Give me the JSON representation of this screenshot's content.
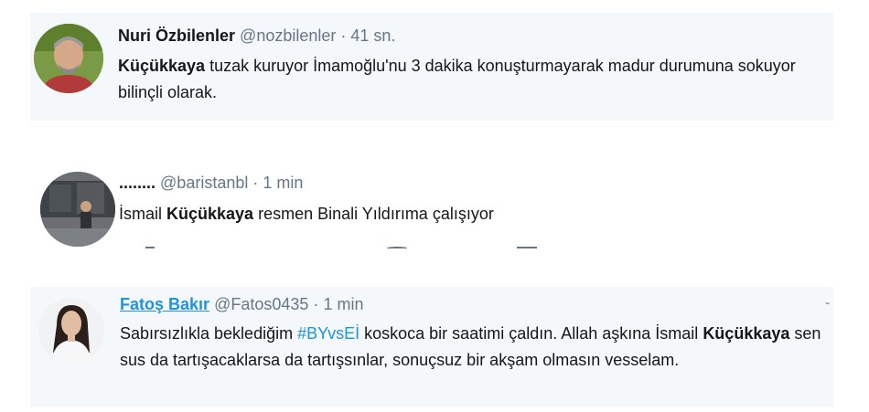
{
  "tweets": [
    {
      "name": "Nuri Özbilenler",
      "handle": "@nozbilenler",
      "separator": "·",
      "time": "41 sn.",
      "text": [
        {
          "t": "Küçükkaya",
          "bold": true
        },
        {
          "t": " tuzak kuruyor İmamoğlu'nu 3 dakika konuşturmayarak madur durumuna sokuyor bilinçli olarak."
        }
      ]
    },
    {
      "name": "........",
      "handle": "@baristanbl",
      "separator": "·",
      "time": "1 min",
      "text": [
        {
          "t": "İsmail "
        },
        {
          "t": "Küçükkaya",
          "bold": true
        },
        {
          "t": " resmen Binali Yıldırıma çalışıyor"
        }
      ]
    },
    {
      "name": "Fatoş Bakır",
      "handle": "@Fatos0435",
      "separator": "·",
      "time": "1 min",
      "text": [
        {
          "t": "Sabırsızlıkla beklediğim "
        },
        {
          "t": "#BYvsEİ",
          "hashtag": true
        },
        {
          "t": " koskoca bir saatimi çaldın. Allah aşkına İsmail "
        },
        {
          "t": "Küçükkaya",
          "bold": true
        },
        {
          "t": " sen sus da tartışacaklarsa da tartışsınlar, sonuçsuz bir akşam olmasın vesselam."
        }
      ]
    }
  ],
  "colors": {
    "link": "#1b95e0",
    "muted": "#657786",
    "tweet_bg": "#f5f8fa",
    "text": "#14171a"
  },
  "icons": [
    "caret-down-icon"
  ]
}
